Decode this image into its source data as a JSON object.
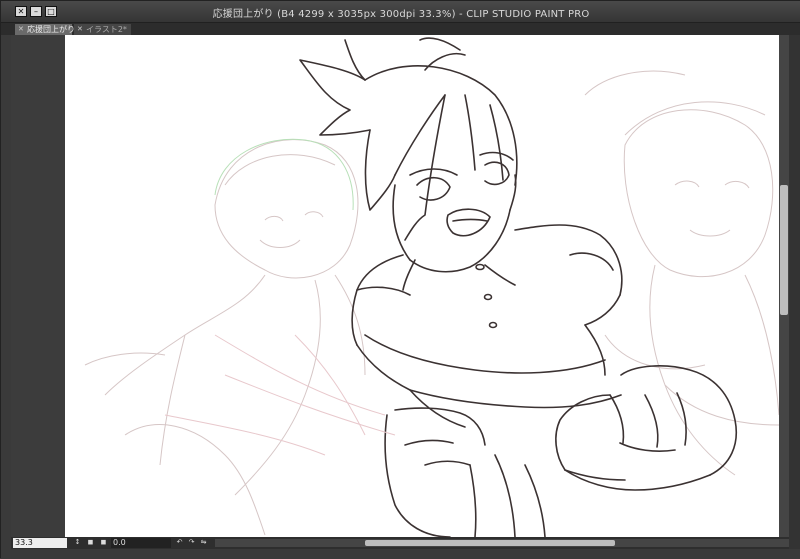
{
  "window": {
    "title": "応援団上がり (B4 4299 x 3035px 300dpi 33.3%)  - CLIP STUDIO PAINT PRO",
    "close_glyph": "✕",
    "minimize_glyph": "–",
    "maximize_glyph": "□"
  },
  "tabs": [
    {
      "label": "応援団上がり",
      "close_glyph": "✕",
      "active": true
    },
    {
      "label": "イラスト2*",
      "close_glyph": "✕",
      "active": false
    }
  ],
  "status": {
    "zoom": "33.3",
    "angle": "0.0"
  },
  "icons": {
    "zoom_stepper": "↕",
    "zoom_fit": "◼",
    "rotate_left": "↶",
    "rotate_right": "↷",
    "flip": "⇋"
  },
  "colors": {
    "ui_background": "#3a3a3a",
    "canvas": "#ffffff",
    "lineart": "#3b3232",
    "sketch": "#c9b9b9"
  }
}
